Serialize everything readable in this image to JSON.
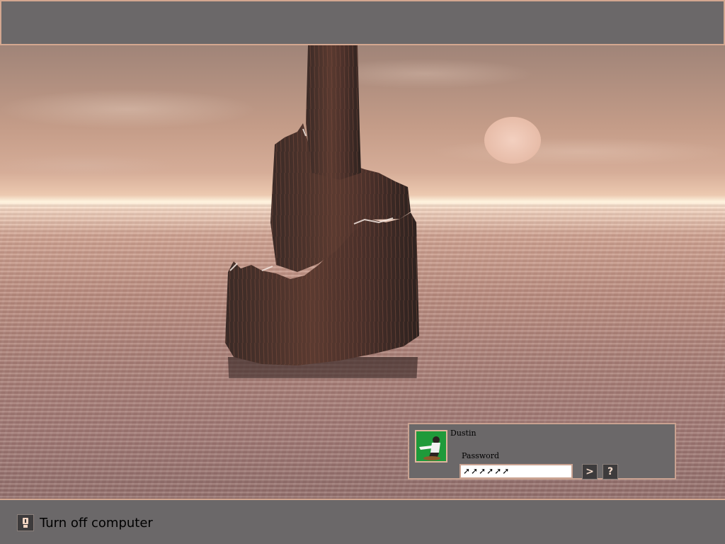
{
  "login": {
    "username": "Dustin",
    "password_label": "Password",
    "password_value": "➚➚➚➚➚➚",
    "go_icon": "arrow-right-icon",
    "help_icon": "question-mark-icon",
    "go_label": ">",
    "help_label": "?"
  },
  "footer": {
    "turn_off_label": "Turn off computer",
    "power_icon": "power-icon"
  },
  "colors": {
    "panel": "#6b6869",
    "border": "#d3a790",
    "button": "#3d3b3c"
  }
}
